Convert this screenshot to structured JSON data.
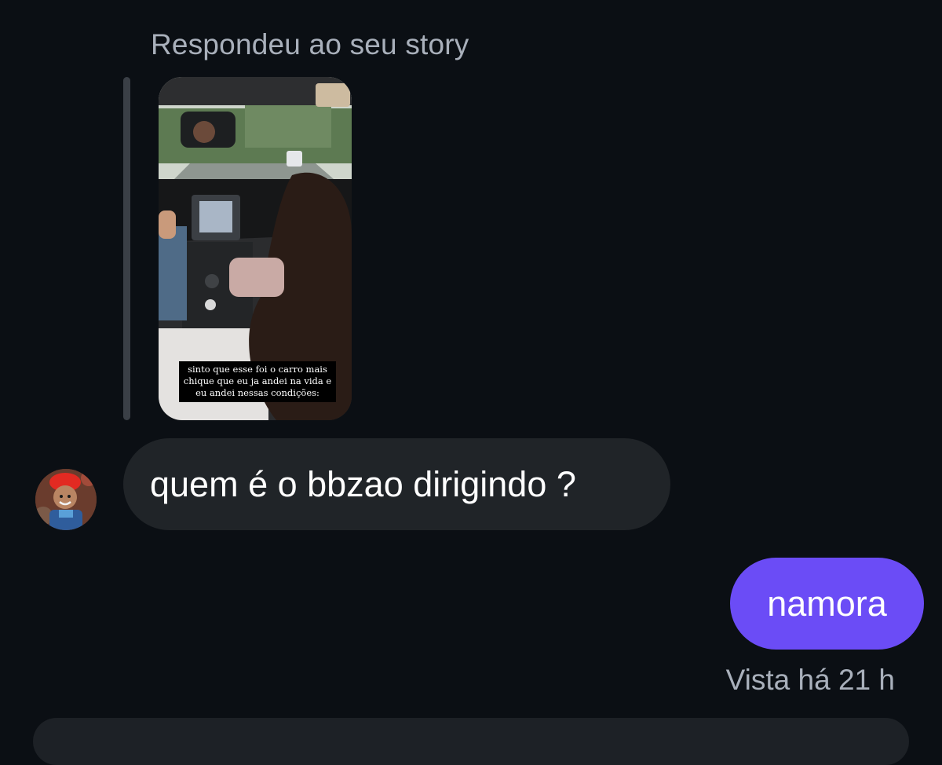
{
  "reply_context": {
    "label": "Respondeu ao seu story",
    "story_caption": "sinto que esse foi o carro mais chique que eu ja andei na vida e eu andei nessas condições:"
  },
  "messages": [
    {
      "direction": "incoming",
      "text": "quem é o bbzao dirigindo ?"
    },
    {
      "direction": "outgoing",
      "text": "namora"
    }
  ],
  "status": {
    "seen": "Vista há 21 h"
  },
  "colors": {
    "background": "#0b0f14",
    "incoming_bubble": "#202428",
    "outgoing_bubble": "#6b4cf6",
    "muted_text": "#a9b0bb"
  }
}
